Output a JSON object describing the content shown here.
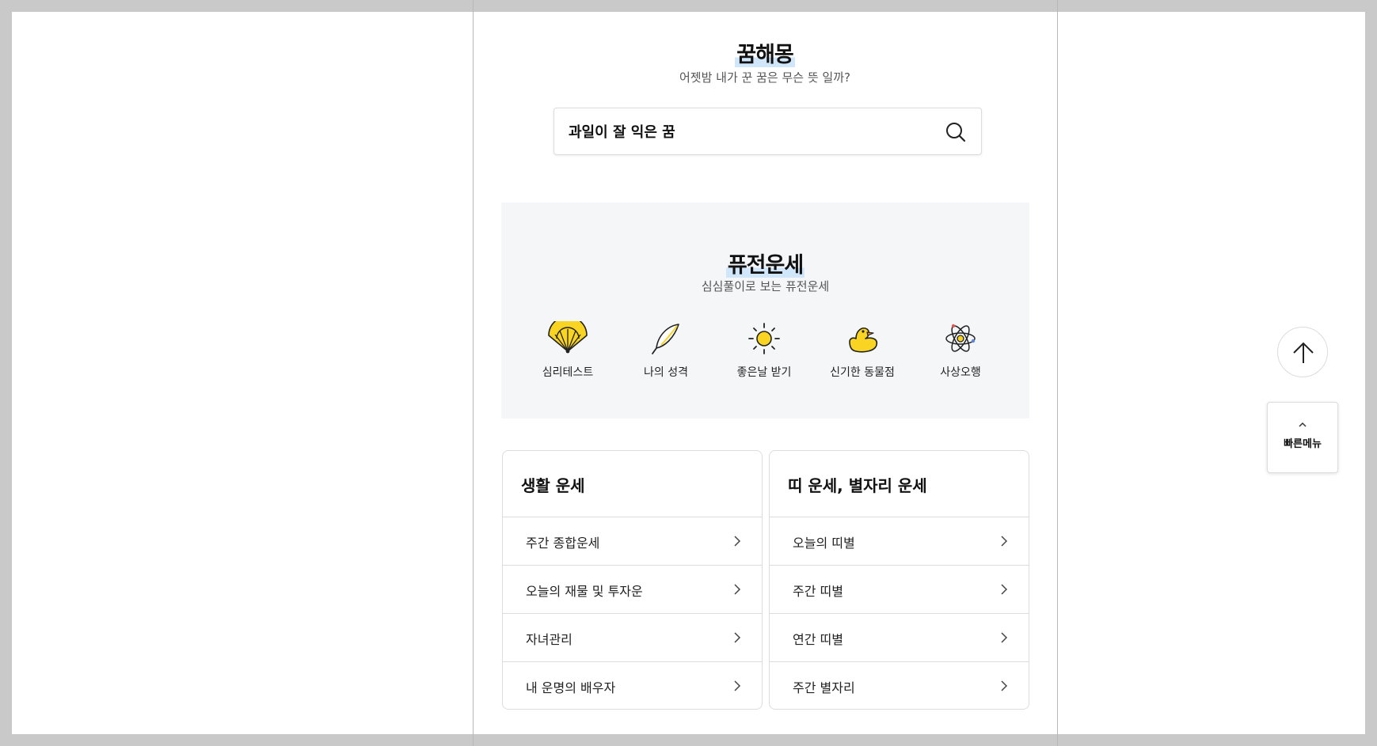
{
  "dream": {
    "title": "꿈해몽",
    "subtitle": "어젯밤 내가 꾼 꿈은 무슨 뜻 일까?",
    "search_value": "과일이 잘 익은 꿈",
    "search_icon": "search-icon"
  },
  "fusion": {
    "title": "퓨전운세",
    "subtitle": "심심풀이로 보는 퓨전운세",
    "items": [
      {
        "label": "심리테스트",
        "icon": "fan-icon"
      },
      {
        "label": "나의 성격",
        "icon": "feather-icon"
      },
      {
        "label": "좋은날 받기",
        "icon": "sun-icon"
      },
      {
        "label": "신기한 동물점",
        "icon": "duck-icon"
      },
      {
        "label": "사상오행",
        "icon": "atom-icon"
      }
    ]
  },
  "life_fortune": {
    "title": "생활 운세",
    "items": [
      "주간 종합운세",
      "오늘의 재물 및 투자운",
      "자녀관리",
      "내 운명의 배우자"
    ]
  },
  "zodiac_fortune": {
    "title": "띠 운세, 별자리 운세",
    "items": [
      "오늘의 띠별",
      "주간 띠별",
      "연간 띠별",
      "주간 별자리"
    ]
  },
  "floating": {
    "top_icon": "arrow-up-icon",
    "quick_menu_label": "빠른메뉴",
    "quick_menu_icon": "chevron-up-icon"
  },
  "colors": {
    "highlight": "#cfe6fb",
    "section_bg": "#f5f6f8",
    "icon_yellow": "#f9d423",
    "border": "#dcdcdc"
  }
}
